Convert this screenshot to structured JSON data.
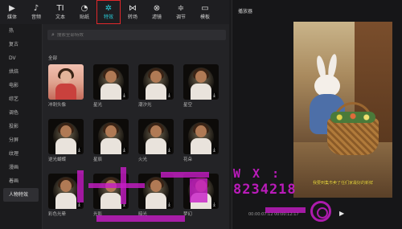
{
  "toolbar": {
    "tools": [
      {
        "label": "媒体",
        "icon": "media-icon"
      },
      {
        "label": "音频",
        "icon": "audio-icon"
      },
      {
        "label": "文本",
        "icon": "text-icon"
      },
      {
        "label": "贴纸",
        "icon": "sticker-icon"
      },
      {
        "label": "特效",
        "icon": "effects-icon"
      },
      {
        "label": "转场",
        "icon": "transition-icon"
      },
      {
        "label": "滤镜",
        "icon": "filter-icon"
      },
      {
        "label": "调节",
        "icon": "adjust-icon"
      },
      {
        "label": "模板",
        "icon": "template-icon"
      }
    ],
    "active_index": 4
  },
  "categories": [
    "热",
    "复古",
    "DV",
    "烘焙",
    "电影",
    "综艺",
    "调色",
    "投影",
    "分屏",
    "纹理",
    "漫画",
    "着画",
    "人物特效"
  ],
  "active_category": "人物特效",
  "search": {
    "placeholder": "搜索全部特效"
  },
  "section_title": "全部",
  "effects": [
    {
      "label": "冲刺头像"
    },
    {
      "label": "星光"
    },
    {
      "label": "潮汐光"
    },
    {
      "label": "星空"
    },
    {
      "label": "逆光蝴蝶"
    },
    {
      "label": "星辰"
    },
    {
      "label": "火光"
    },
    {
      "label": "花朵"
    },
    {
      "label": "彩色光晕"
    },
    {
      "label": "光影"
    },
    {
      "label": "暗光"
    },
    {
      "label": "梦幻"
    }
  ],
  "player": {
    "title": "播放器",
    "subtitle": "我要到集市卖了任们家最好的新鲜",
    "timecode": "00:00:07:12  00:00:12:17",
    "play_icon": "play-icon"
  },
  "watermark": {
    "line1": "W X :",
    "line2": "8234218"
  },
  "colors": {
    "accent": "#2ad3e0",
    "highlight_box": "#e0282b",
    "watermark": "#c81cc8",
    "subtitle": "#ffe34a"
  }
}
